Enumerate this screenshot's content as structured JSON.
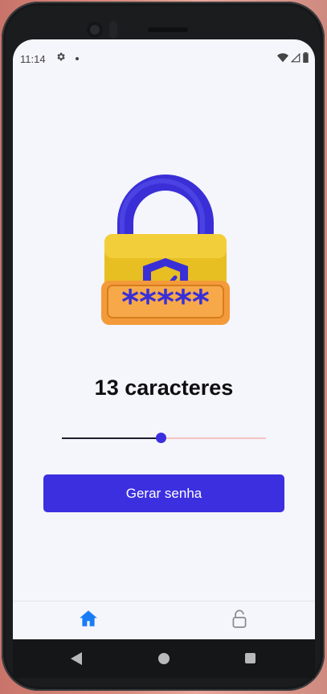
{
  "status_bar": {
    "time": "11:14",
    "gear_icon": "gear-icon",
    "wifi_icon": "wifi-icon",
    "signal_icon": "signal-icon",
    "battery_icon": "battery-icon"
  },
  "hero": {
    "icon": "padlock-password-icon",
    "mask": "*****"
  },
  "password_length": {
    "label": "13 caracteres",
    "slider_value": 13,
    "slider_fraction": 0.49
  },
  "generate_button": {
    "label": "Gerar senha"
  },
  "tab_bar": {
    "items": [
      {
        "icon": "home-icon",
        "active": true
      },
      {
        "icon": "lock-icon",
        "active": false
      }
    ]
  },
  "colors": {
    "accent": "#3b2fe0",
    "background": "#f5f5fc",
    "tab_active": "#1a7cf5",
    "slider_inactive": "#f3c3c0"
  }
}
